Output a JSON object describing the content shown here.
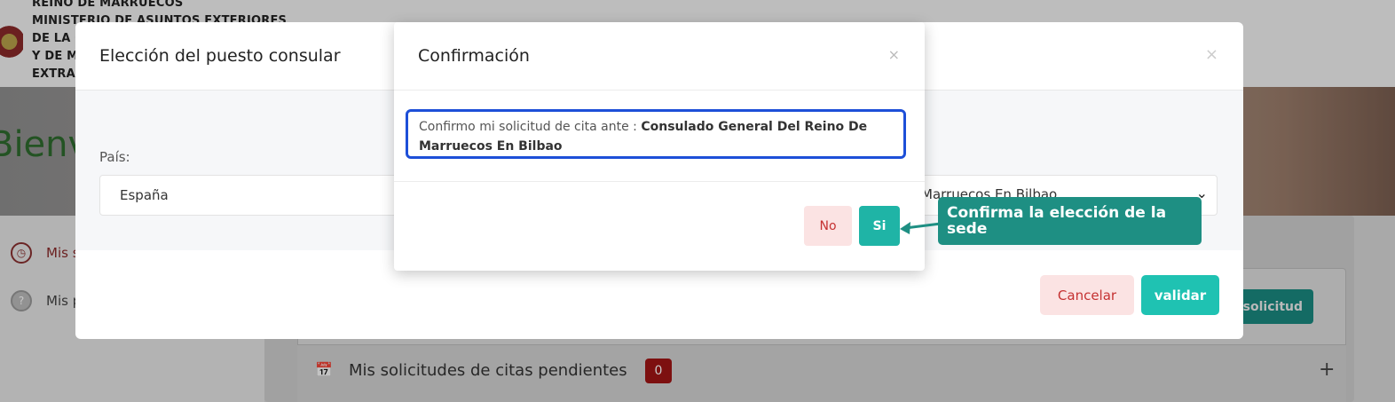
{
  "background": {
    "ministry_lines": [
      "REINO DE MARRUECOS",
      "MINISTERIO DE ASUNTOS EXTERIORES",
      "DE LA C",
      "Y DE M",
      "EXTRA"
    ],
    "welcome": "Bienv",
    "sidebar": {
      "items": [
        {
          "label": "Mis s",
          "icon": "clock-icon"
        },
        {
          "label": "Mis p",
          "icon": "question-icon"
        }
      ]
    },
    "new_request_button": "solicitud",
    "pending": {
      "label": "Mis solicitudes de citas pendientes",
      "count": "0",
      "expand": "+"
    }
  },
  "main_modal": {
    "title": "Elección del puesto consular",
    "close": "×",
    "country_label": "País:",
    "country_value": "España",
    "post_value": "Marruecos En Bilbao",
    "cancel_label": "Cancelar",
    "validate_label": "validar"
  },
  "confirm_modal": {
    "title": "Confirmación",
    "close": "×",
    "message_prefix": "Confirmo mi solicitud de cita ante : ",
    "consulate": "Consulado General Del Reino De Marruecos En Bilbao",
    "no_label": "No",
    "yes_label": "Si"
  },
  "annotation": {
    "text": "Confirma la elección de la sede"
  },
  "colors": {
    "accent_teal": "#1fb4a6",
    "cancel_red": "#c53232",
    "highlight_blue": "#1d4fd8",
    "callout_green": "#1e8f83"
  }
}
